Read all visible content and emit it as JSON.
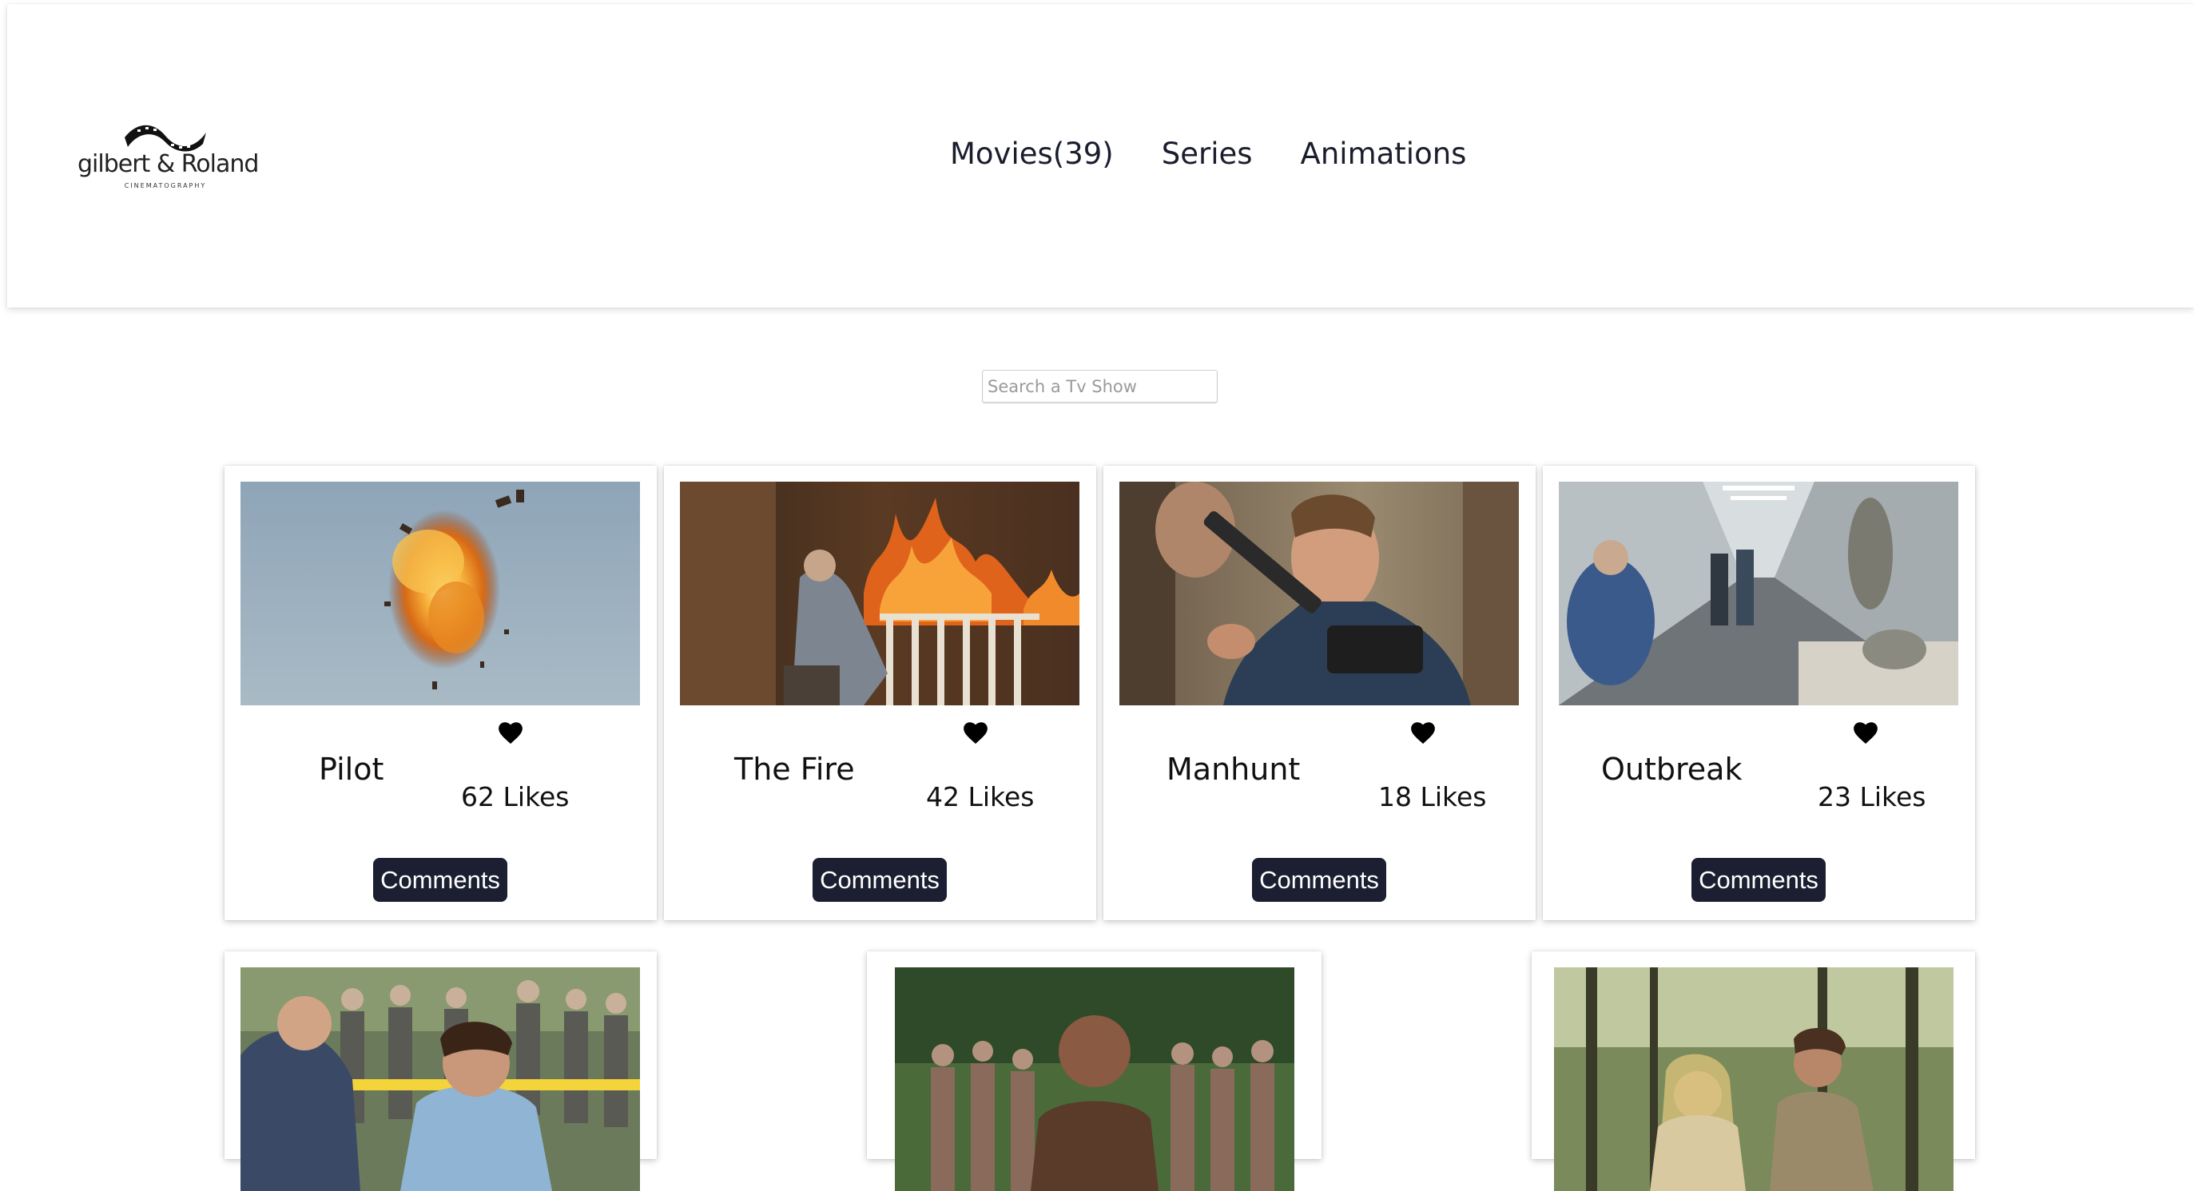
{
  "header": {
    "logo": {
      "name": "gilbert & Roland",
      "subtitle": "CINEMATOGRAPHY"
    },
    "nav": [
      {
        "label": "Movies(39)"
      },
      {
        "label": "Series"
      },
      {
        "label": "Animations"
      }
    ]
  },
  "search": {
    "placeholder": "Search a Tv Show",
    "value": ""
  },
  "shows": [
    {
      "title": "Pilot",
      "likes": "62 Likes",
      "comments_label": "Comments",
      "image": "explosion-in-sky"
    },
    {
      "title": "The Fire",
      "likes": "42 Likes",
      "comments_label": "Comments",
      "image": "house-porch-on-fire"
    },
    {
      "title": "Manhunt",
      "likes": "18 Likes",
      "comments_label": "Comments",
      "image": "man-with-rifle-in-woods"
    },
    {
      "title": "Outbreak",
      "likes": "23 Likes",
      "comments_label": "Comments",
      "image": "hospital-hallway"
    },
    {
      "image": "crowd-and-police-officer"
    },
    {
      "image": "bald-man-in-crowd"
    },
    {
      "image": "two-people-in-forest"
    }
  ],
  "colors": {
    "nav_text": "#1a1d2c",
    "button_bg": "#1b1f31",
    "button_text": "#ffffff"
  },
  "icons": {
    "heart": "heart-icon"
  }
}
